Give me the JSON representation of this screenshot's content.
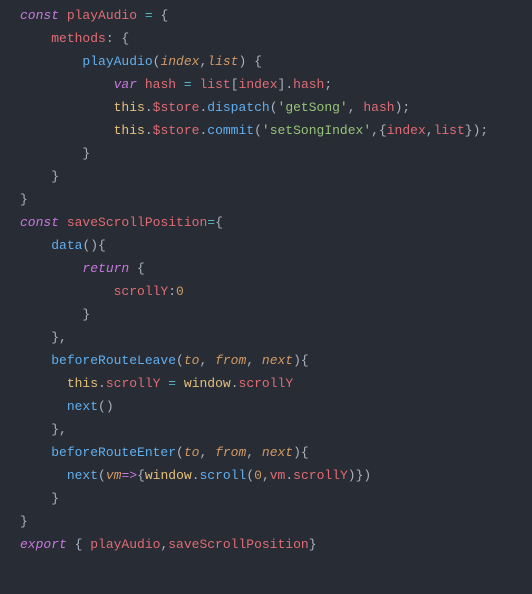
{
  "kw": {
    "const": "const",
    "var": "var",
    "return": "return",
    "export": "export",
    "this": "this"
  },
  "id": {
    "playAudio": "playAudio",
    "saveScrollPosition": "saveScrollPosition",
    "methods": "methods",
    "data": "data",
    "beforeRouteLeave": "beforeRouteLeave",
    "beforeRouteEnter": "beforeRouteEnter",
    "next": "next",
    "hash": "hash",
    "list": "list",
    "index": "index",
    "to": "to",
    "from": "from",
    "vm": "vm",
    "store": "$store",
    "dispatch": "dispatch",
    "commit": "commit",
    "scrollY": "scrollY",
    "window": "window",
    "scroll": "scroll"
  },
  "str": {
    "getSong": "'getSong'",
    "setSongIndex": "'setSongIndex'"
  },
  "num": {
    "zero": "0"
  }
}
